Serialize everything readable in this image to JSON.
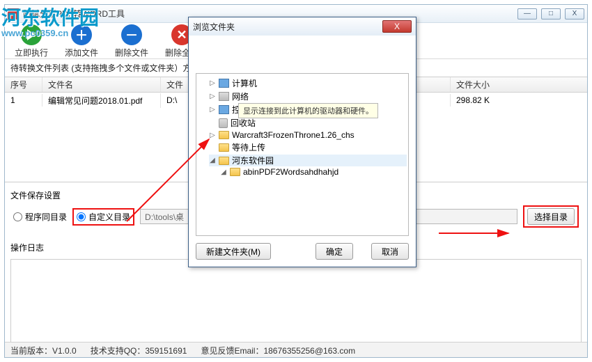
{
  "colors": {
    "accent_red": "#e11",
    "brand_blue": "#0a9acb"
  },
  "watermark": {
    "line1": "河东软件园",
    "line2": "www.pc0359.cn"
  },
  "main_window": {
    "title": "阿斌分享PDF转WORD工具",
    "winbtn_min": "—",
    "winbtn_max": "□",
    "winbtn_close": "X"
  },
  "toolbar": {
    "run": {
      "label": "立即执行"
    },
    "add": {
      "label": "添加文件",
      "glyph": "＋"
    },
    "del": {
      "label": "删除文件",
      "glyph": "－"
    },
    "delall": {
      "label": "删除全部",
      "glyph": "✕"
    }
  },
  "list_caption": "待转换文件列表 (支持拖拽多个文件或文件夹）方",
  "columns": {
    "idx": "序号",
    "name": "文件名",
    "path": "文件",
    "size": "文件大小"
  },
  "rows": [
    {
      "idx": "1",
      "name": "编辑常见问题2018.01.pdf",
      "path": "D:\\",
      "size": "298.82 K"
    }
  ],
  "save_section": {
    "label": "文件保存设置",
    "radio_same": "程序同目录",
    "radio_custom": "自定义目录",
    "path_value": "D:\\tools\\桌",
    "select_dir": "选择目录"
  },
  "oplog_label": "操作日志",
  "status": {
    "version": "当前版本：V1.0.0",
    "tech_qq": "技术支持QQ：359151691",
    "feedback": "意见反馈Email：18676355256@163.com"
  },
  "dialog": {
    "title": "浏览文件夹",
    "close_glyph": "X",
    "tooltip": "显示连接到此计算机的驱动器和硬件。",
    "tree": {
      "computer": "计算机",
      "network": "网络",
      "control": "控制面板",
      "recycle": "回收站",
      "wc3": "Warcraft3FrozenThrone1.26_chs",
      "pending": "等待上传",
      "hedong": "河东软件园",
      "abin": "abinPDF2Wordsahdhahjd"
    },
    "buttons": {
      "new_folder": "新建文件夹(M)",
      "ok": "确定",
      "cancel": "取消"
    }
  }
}
